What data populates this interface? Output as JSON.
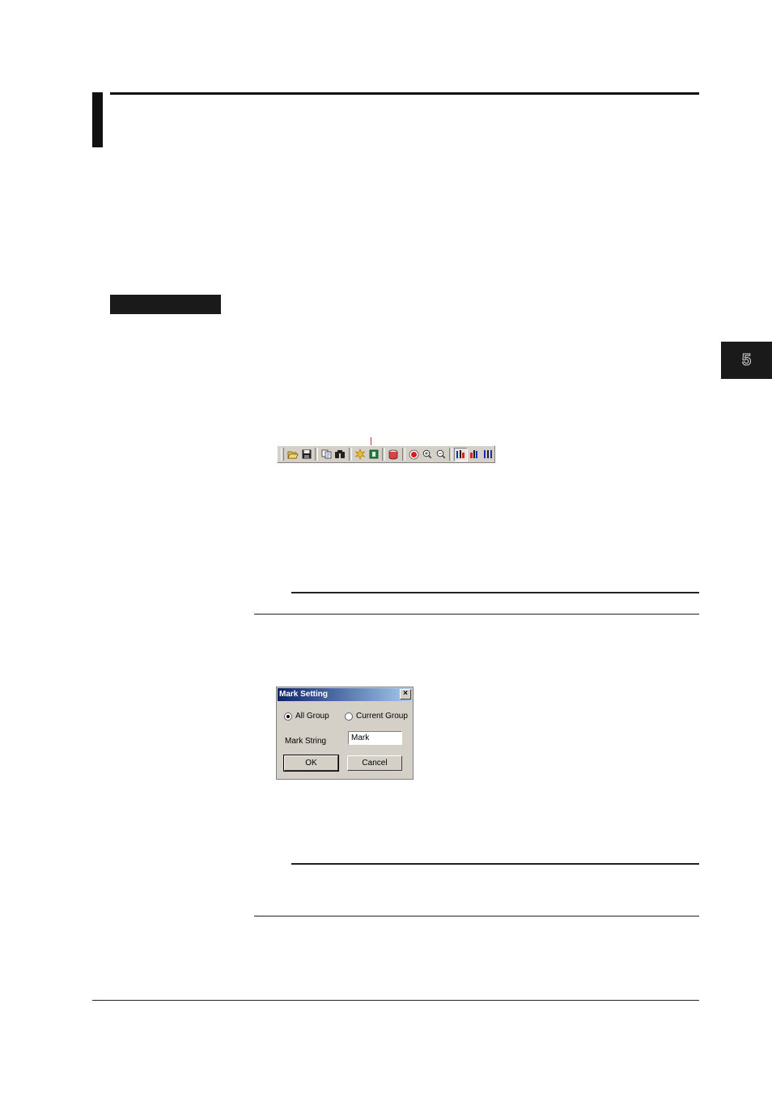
{
  "chapter_number": "5",
  "toolbar": {
    "icons": [
      "open-icon",
      "save-icon",
      "copy-icon",
      "find-icon",
      "star-icon",
      "export-icon",
      "database-icon",
      "record-icon",
      "zoom-in-icon",
      "zoom-out-icon",
      "cursor-a-icon",
      "cursor-b-icon",
      "cursor-bars-icon"
    ]
  },
  "dialog": {
    "title": "Mark Setting",
    "close_label": "×",
    "radio_all_group": "All Group",
    "radio_current_group": "Current Group",
    "mark_string_label": "Mark String",
    "mark_string_value": "Mark",
    "ok_label": "OK",
    "cancel_label": "Cancel"
  }
}
